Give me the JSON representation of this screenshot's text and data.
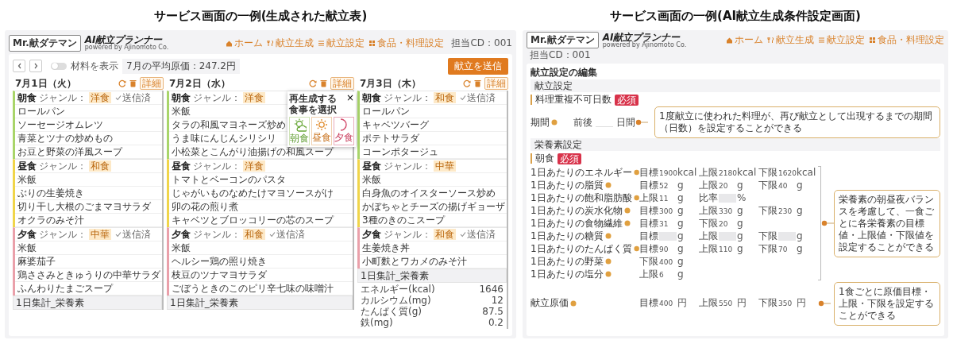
{
  "menu_screen": {
    "caption": "サービス画面の一例(生成された献立表)",
    "header": {
      "logo": "Mr.献ダテマン",
      "app_title": "AI献立プランナー",
      "powered_by": "powered by Ajinomoto Co.",
      "nav": [
        {
          "kind": "home",
          "label": "ホーム"
        },
        {
          "kind": "cutlery",
          "label": "献立生成"
        },
        {
          "kind": "list",
          "label": "献立設定"
        },
        {
          "kind": "grid",
          "label": "食品・料理設定"
        }
      ],
      "user": "担当CD：001"
    },
    "toolbar": {
      "toggle": {
        "label": "材料を表示",
        "on": false
      },
      "average": "7月の平均原価：247.2円",
      "send_button": "献立を送信"
    },
    "days": [
      {
        "date": "7月1日（火）",
        "detail_button": "詳細",
        "meals": [
          {
            "kind": "breakfast",
            "name": "朝食",
            "genre_label": "ジャンル：",
            "genre": "洋食",
            "sent": true,
            "sent_label": "送信済",
            "dishes": [
              "ロールパン",
              "ソーセージオムレツ",
              "青菜とツナの炒めもの",
              "お豆と野菜の洋風スープ"
            ]
          },
          {
            "kind": "lunch",
            "name": "昼食",
            "genre_label": "ジャンル：",
            "genre": "和食",
            "sent": false,
            "dishes": [
              "米飯",
              "ぶりの生姜焼き",
              "切り干し大根のごまマヨサラダ",
              "オクラのみそ汁"
            ]
          },
          {
            "kind": "dinner",
            "name": "夕食",
            "genre_label": "ジャンル：",
            "genre": "中華",
            "sent": true,
            "sent_label": "送信済",
            "dishes": [
              "米飯",
              "麻婆茄子",
              "鶏ささみときゅうりの中華サラダ",
              "ふんわりたまごスープ"
            ]
          }
        ],
        "summary": "1日集計_栄養素"
      },
      {
        "date": "7月2日（水）",
        "detail_button": "詳細",
        "meals": [
          {
            "kind": "breakfast",
            "name": "朝食",
            "genre_label": "ジャンル：",
            "genre": "洋食",
            "sent": false,
            "dishes": [
              "米飯",
              "タラの和風マヨネーズ炒め",
              "うま味にんじんシリシリ",
              "小松菜とこんがり油揚げの和風スープ"
            ]
          },
          {
            "kind": "lunch",
            "name": "昼食",
            "genre_label": "ジャンル：",
            "genre": "洋食",
            "sent": false,
            "dishes": [
              "トマトとベーコンのパスタ",
              "じゃがいものなめたけマヨソースがけ",
              "卯の花の煎り煮",
              "キャベツとブロッコリーの芯のスープ"
            ]
          },
          {
            "kind": "dinner",
            "name": "夕食",
            "genre_label": "ジャンル：",
            "genre": "和食",
            "sent": true,
            "sent_label": "送信済",
            "dishes": [
              "米飯",
              "ヘルシー鶏の照り焼き",
              "枝豆のツナマヨサラダ",
              "ごぼうときのこのピリ辛七味の味噌汁"
            ]
          }
        ],
        "summary": "1日集計_栄養素"
      },
      {
        "date": "7月3日（木）",
        "detail_button": "詳細",
        "meals": [
          {
            "kind": "breakfast",
            "name": "朝食",
            "genre_label": "ジャンル：",
            "genre": "和食",
            "sent": true,
            "sent_label": "送信済",
            "dishes": [
              "ロールパン",
              "キャベツバーグ",
              "ポテトサラダ",
              "コーンポタージュ"
            ]
          },
          {
            "kind": "lunch",
            "name": "昼食",
            "genre_label": "ジャンル：",
            "genre": "中華",
            "sent": false,
            "dishes": [
              "米飯",
              "白身魚のオイスターソース炒め",
              "かぼちゃとチーズの揚げギョーザ",
              "3種のきのこスープ"
            ]
          },
          {
            "kind": "dinner",
            "name": "夕食",
            "genre_label": "ジャンル：",
            "genre": "和食",
            "sent": true,
            "sent_label": "送信済",
            "dishes": [
              "生姜焼き丼",
              "小町麩とワカメのみそ汁"
            ]
          }
        ],
        "summary": "1日集計_栄養素",
        "nutrients": [
          {
            "label": "エネルギー(kcal)",
            "value": "1646"
          },
          {
            "label": "カルシウム(mg)",
            "value": "12"
          },
          {
            "label": "たんぱく質(g)",
            "value": "87.5"
          },
          {
            "label": "鉄(mg)",
            "value": "0.2"
          }
        ]
      }
    ],
    "popup": {
      "title": "再生成する食事を選択",
      "close": "×",
      "options": [
        {
          "kind": "breakfast",
          "label": "朝食"
        },
        {
          "kind": "lunch",
          "label": "昼食"
        },
        {
          "kind": "dinner",
          "label": "夕食"
        }
      ]
    }
  },
  "settings_screen": {
    "caption": "サービス画面の一例(AI献立生成条件設定画面)",
    "header": {
      "logo": "Mr.献ダテマン",
      "app_title": "AI献立プランナー",
      "powered_by": "powered by Ajinomoto Co.",
      "nav": [
        {
          "kind": "home",
          "label": "ホーム"
        },
        {
          "kind": "cutlery",
          "label": "献立生成"
        },
        {
          "kind": "list",
          "label": "献立設定"
        },
        {
          "kind": "grid",
          "label": "食品・料理設定"
        }
      ],
      "user": "担当CD：001"
    },
    "page_title": "献立設定の編集",
    "menu_section": {
      "title": "献立設定",
      "group": "料理重複不可日数",
      "required": "必須",
      "row": {
        "label": "期間",
        "prefix": "前後",
        "unit": "日間"
      },
      "callout": "1度献立に使われた料理が、再び献立として出現するまでの期間（日数）を設定することができる"
    },
    "nutrient_section": {
      "title": "栄養素設定",
      "group": "朝食",
      "required": "必須",
      "rows": [
        {
          "label": "1日あたりのエネルギー",
          "fields": [
            {
              "label": "目標",
              "value": "1900",
              "unit": "kcal"
            },
            {
              "label": "上限",
              "value": "2180",
              "unit": "kcal"
            },
            {
              "label": "下限",
              "value": "1620",
              "unit": "kcal"
            }
          ]
        },
        {
          "label": "1日あたりの脂質",
          "fields": [
            {
              "label": "目標",
              "value": "52",
              "unit": "g"
            },
            {
              "label": "上限",
              "value": "20",
              "unit": "g"
            },
            {
              "label": "下限",
              "value": "40",
              "unit": "g"
            }
          ]
        },
        {
          "label": "1日あたりの飽和脂肪酸",
          "fields": [
            {
              "label": "上限",
              "value": "11",
              "unit": "g"
            },
            {
              "label": "比率",
              "masked": true,
              "unit": "%"
            }
          ]
        },
        {
          "label": "1日あたりの炭水化物",
          "fields": [
            {
              "label": "目標",
              "value": "300",
              "unit": "g"
            },
            {
              "label": "上限",
              "value": "330",
              "unit": "g"
            },
            {
              "label": "下限",
              "value": "230",
              "unit": "g"
            }
          ]
        },
        {
          "label": "1日あたりの食物繊維",
          "fields": [
            {
              "label": "目標",
              "value": "31",
              "unit": "g"
            },
            {
              "label": "下限",
              "value": "20",
              "unit": "g"
            }
          ]
        },
        {
          "label": "1日あたりの糖質",
          "fields": [
            {
              "label": "目標",
              "masked": true,
              "unit": "g"
            },
            {
              "label": "上限",
              "masked": true,
              "unit": "g"
            },
            {
              "label": "下限",
              "masked": true,
              "unit": "g"
            }
          ]
        },
        {
          "label": "1日あたりのたんぱく質",
          "fields": [
            {
              "label": "目標",
              "value": "90",
              "unit": "g"
            },
            {
              "label": "上限",
              "value": "110",
              "unit": "g"
            },
            {
              "label": "下限",
              "value": "70",
              "unit": "g"
            }
          ]
        },
        {
          "label": "1日あたりの野菜",
          "fields": [
            {
              "label": "下限",
              "value": "400",
              "unit": "g"
            }
          ]
        },
        {
          "label": "1日あたりの塩分",
          "fields": [
            {
              "label": "上限",
              "value": "6",
              "unit": "g"
            }
          ]
        },
        {
          "label": "献立原価",
          "fields": [
            {
              "label": "目標",
              "value": "400",
              "unit": "円"
            },
            {
              "label": "上限",
              "value": "550",
              "unit": "円"
            },
            {
              "label": "下限",
              "value": "350",
              "unit": "円"
            }
          ]
        }
      ],
      "callouts": [
        "栄養素の朝昼夜バランスを考慮して、一食ごとに各栄養素の目標値・上限値・下限値を設定することができる",
        "1食ごとに原価目標・上限・下限を設定することができる"
      ]
    }
  }
}
